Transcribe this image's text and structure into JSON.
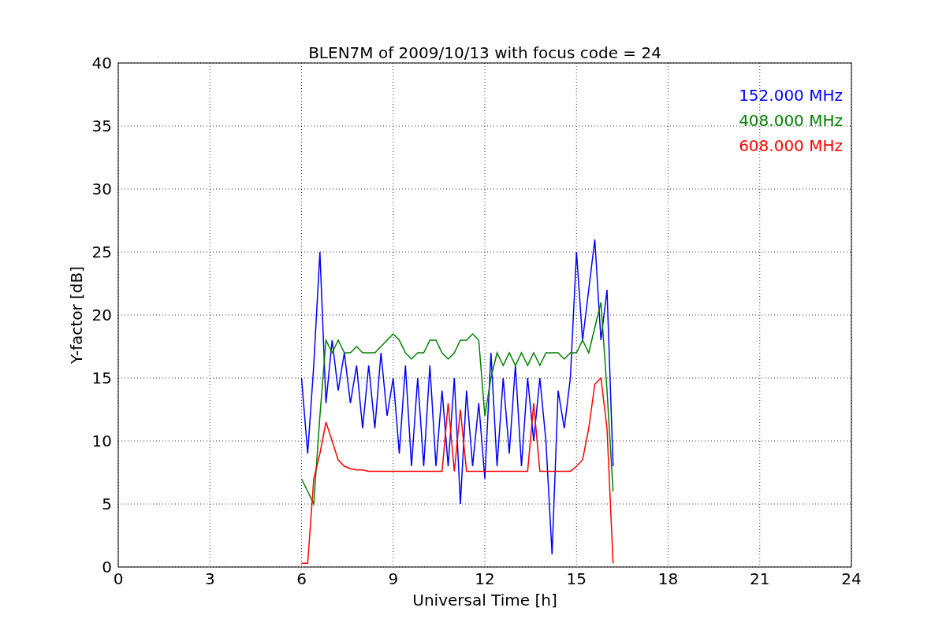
{
  "figure": {
    "chart_data": {
      "type": "line",
      "title": "BLEN7M of 2009/10/13 with focus code = 24",
      "xlabel": "Universal Time [h]",
      "ylabel": "Y-factor [dB]",
      "x": [
        6.0,
        6.2,
        6.4,
        6.6,
        6.8,
        7.0,
        7.2,
        7.4,
        7.6,
        7.8,
        8.0,
        8.2,
        8.4,
        8.6,
        8.8,
        9.0,
        9.2,
        9.4,
        9.6,
        9.8,
        10.0,
        10.2,
        10.4,
        10.6,
        10.8,
        11.0,
        11.2,
        11.4,
        11.6,
        11.8,
        12.0,
        12.2,
        12.4,
        12.6,
        12.8,
        13.0,
        13.2,
        13.4,
        13.6,
        13.8,
        14.0,
        14.2,
        14.4,
        14.6,
        14.8,
        15.0,
        15.2,
        15.4,
        15.6,
        15.8,
        16.0,
        16.2
      ],
      "series": [
        {
          "name": "152.000 MHz",
          "color": "#0000ff",
          "values": [
            15,
            9,
            16,
            25,
            13,
            18,
            14,
            17,
            13,
            16,
            11,
            16,
            11,
            17,
            12,
            15,
            9,
            16,
            8,
            15,
            8,
            16,
            8,
            14,
            8,
            15,
            5,
            14,
            8,
            13,
            7,
            17,
            8,
            15,
            9,
            16,
            8,
            15,
            10,
            15,
            10,
            1,
            14,
            11,
            15,
            25,
            18,
            22,
            26,
            18,
            22,
            8
          ]
        },
        {
          "name": "408.000 MHz",
          "color": "#008000",
          "values": [
            7,
            6,
            5,
            12,
            18,
            17,
            18,
            17,
            17,
            17.5,
            17,
            17,
            17,
            17.5,
            18,
            18.5,
            18,
            17,
            16.5,
            17,
            17,
            18,
            18,
            17,
            16.5,
            17,
            18,
            18,
            18.5,
            18,
            12,
            15,
            17,
            16,
            17,
            16,
            17,
            16,
            17,
            16,
            17,
            17,
            17,
            16.5,
            17,
            17,
            18,
            17,
            19,
            21,
            14,
            6
          ]
        },
        {
          "name": "608.000 MHz",
          "color": "#ff0000",
          "values": [
            0.3,
            0.3,
            7,
            9,
            11.5,
            10,
            8.5,
            8,
            7.8,
            7.7,
            7.7,
            7.6,
            7.6,
            7.6,
            7.6,
            7.6,
            7.6,
            7.6,
            7.6,
            7.6,
            7.6,
            7.6,
            7.6,
            7.6,
            13,
            7.6,
            12.5,
            7.6,
            7.6,
            7.6,
            7.6,
            7.6,
            7.6,
            7.6,
            7.6,
            7.6,
            7.6,
            7.6,
            13,
            7.6,
            7.6,
            7.6,
            7.6,
            7.6,
            7.6,
            8,
            8.5,
            11,
            14.5,
            15,
            11,
            0.3
          ]
        }
      ],
      "grid": true,
      "xlim": [
        0,
        24
      ],
      "ylim": [
        0,
        40
      ],
      "xticks": [
        0,
        3,
        6,
        9,
        12,
        15,
        18,
        21,
        24
      ],
      "yticks": [
        0,
        5,
        10,
        15,
        20,
        25,
        30,
        35,
        40
      ]
    }
  }
}
